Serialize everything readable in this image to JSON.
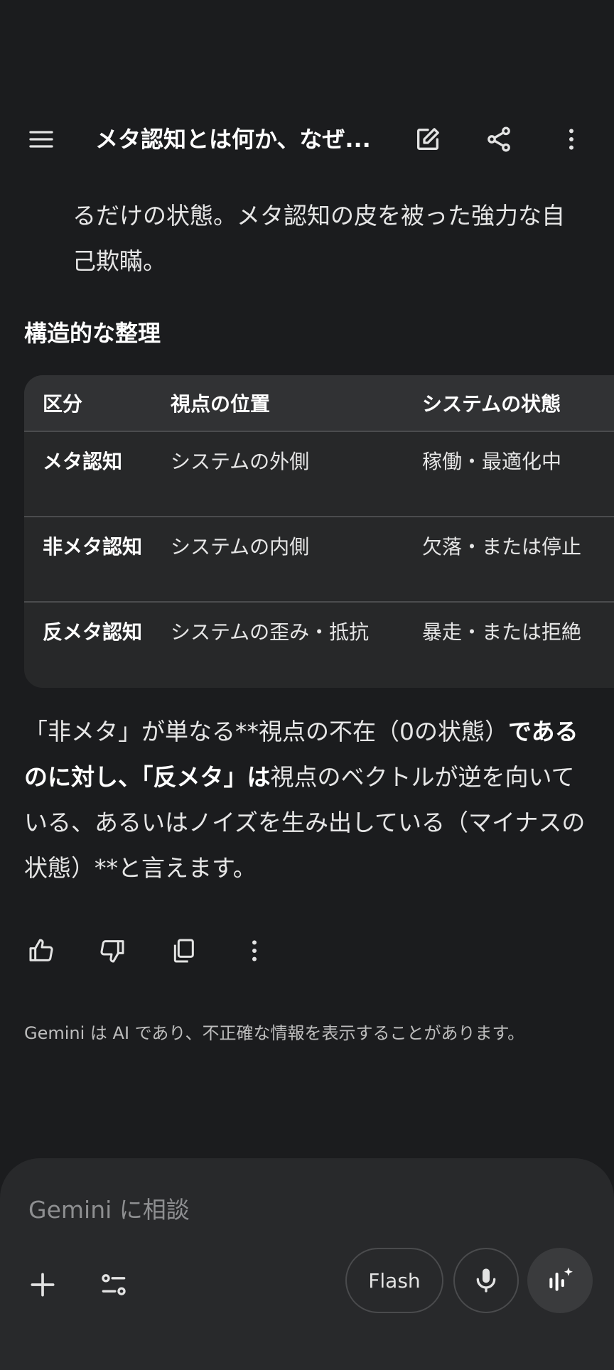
{
  "header": {
    "title": "メタ認知とは何か、なぜ...",
    "icons": [
      "menu-icon",
      "edit-icon",
      "share-icon",
      "more-vert-icon"
    ]
  },
  "content": {
    "continued_text": "るだけの状態。メタ認知の皮を被った強力な自己欺瞞。",
    "section_heading": "構造的な整理",
    "table": {
      "headers": [
        "区分",
        "視点の位置",
        "システムの状態"
      ],
      "rows": [
        [
          "メタ認知",
          "システムの外側",
          "稼働・最適化中"
        ],
        [
          "非メタ認知",
          "システムの内側",
          "欠落・または停止"
        ],
        [
          "反メタ認知",
          "システムの歪み・抵抗",
          "暴走・または拒絶"
        ]
      ]
    },
    "paragraph": {
      "p1": "「非メタ」が単なる**視点の不在（0の状態）",
      "b1": "であるのに対し、「反メタ」は",
      "p2": "視点のベクトルが逆を向いている、あるいはノイズを生み出している（マイナスの状態）**と言えます。"
    }
  },
  "actions": {
    "icons": [
      "thumb-up-icon",
      "thumb-down-icon",
      "copy-icon",
      "more-vert-icon"
    ]
  },
  "disclaimer": "Gemini は AI であり、不正確な情報を表示することがあります。",
  "composer": {
    "placeholder": "Gemini に相談",
    "model_label": "Flash",
    "icons": [
      "plus-icon",
      "tools-icon",
      "mic-icon",
      "live-icon"
    ]
  },
  "colors": {
    "background": "#1b1c1e",
    "composer": "#28292b",
    "table_bg": "#272829",
    "table_header": "#313234",
    "text": "#e3e3e3"
  }
}
